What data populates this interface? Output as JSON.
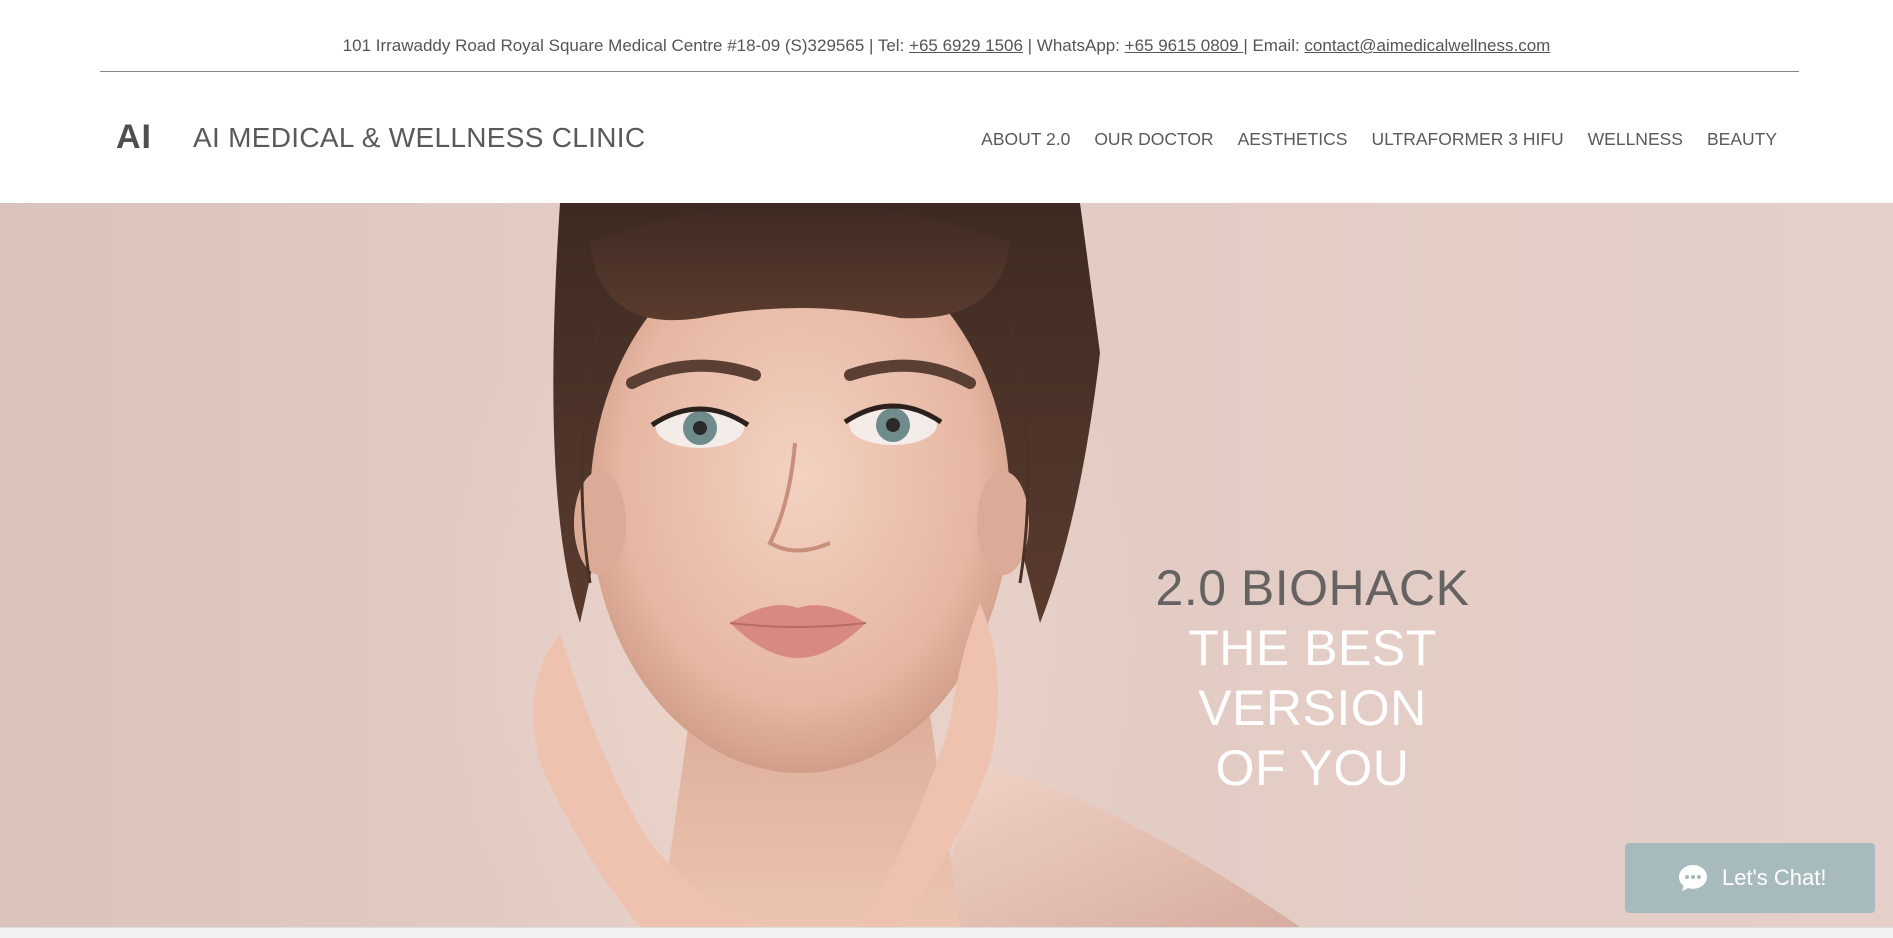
{
  "contact": {
    "address": "101 Irrawaddy Road Royal Square Medical Centre #18-09 (S)329565 | Tel: ",
    "tel": "+65 6929 1506",
    "whatsapp_prefix": " | WhatsApp: ",
    "whatsapp": "+65 9615 0809 ",
    "email_prefix": "| Email: ",
    "email": "contact@aimedicalwellness.com"
  },
  "header": {
    "logo": "AI",
    "title": "AI MEDICAL & WELLNESS CLINIC"
  },
  "nav": {
    "items": [
      {
        "label": "ABOUT 2.0"
      },
      {
        "label": "OUR DOCTOR"
      },
      {
        "label": "AESTHETICS"
      },
      {
        "label": "ULTRAFORMER 3 HIFU"
      },
      {
        "label": "WELLNESS"
      },
      {
        "label": "BEAUTY"
      }
    ]
  },
  "hero": {
    "line1": "2.0 BIOHACK",
    "line2": "THE BEST VERSION",
    "line3": "OF YOU",
    "image": "portrait-photo"
  },
  "chat": {
    "label": "Let's Chat!",
    "icon": "chat-bubble-icon"
  },
  "colors": {
    "hero_background": "#e3ccc4",
    "chat_button": "#a7babd",
    "text_dark": "#555555"
  }
}
